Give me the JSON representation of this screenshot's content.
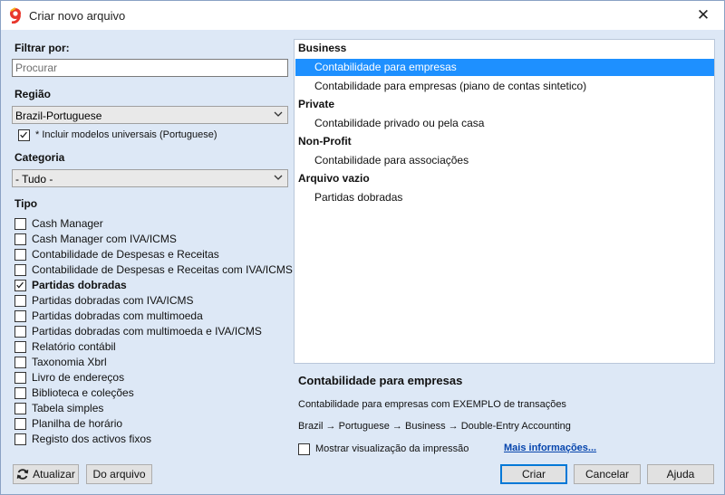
{
  "window": {
    "title": "Criar novo arquivo",
    "close_glyph": "✕",
    "icon": "app-logo-icon"
  },
  "filter": {
    "label": "Filtrar por:",
    "search_placeholder": "Procurar",
    "search_value": ""
  },
  "region": {
    "label": "Região",
    "selected": "Brazil-Portuguese",
    "include_universal": {
      "label": "* Incluir modelos universais (Portuguese)",
      "checked": true
    }
  },
  "category": {
    "label": "Categoria",
    "selected": "- Tudo -"
  },
  "type": {
    "label": "Tipo",
    "items": [
      {
        "label": "Cash Manager",
        "checked": false
      },
      {
        "label": "Cash Manager com IVA/ICMS",
        "checked": false
      },
      {
        "label": "Contabilidade de Despesas e Receitas",
        "checked": false
      },
      {
        "label": "Contabilidade de Despesas e Receitas com IVA/ICMS",
        "checked": false
      },
      {
        "label": "Partidas dobradas",
        "checked": true
      },
      {
        "label": "Partidas dobradas com IVA/ICMS",
        "checked": false
      },
      {
        "label": "Partidas dobradas com multimoeda",
        "checked": false
      },
      {
        "label": "Partidas dobradas com multimoeda e IVA/ICMS",
        "checked": false
      },
      {
        "label": "Relatório contábil",
        "checked": false
      },
      {
        "label": "Taxonomia Xbrl",
        "checked": false
      },
      {
        "label": "Livro de endereços",
        "checked": false
      },
      {
        "label": "Biblioteca e coleções",
        "checked": false
      },
      {
        "label": "Tabela simples",
        "checked": false
      },
      {
        "label": "Planilha de horário",
        "checked": false
      },
      {
        "label": "Registo dos activos fixos",
        "checked": false
      }
    ]
  },
  "templates": {
    "groups": [
      {
        "name": "Business",
        "items": [
          {
            "label": "Contabilidade para empresas",
            "selected": true
          },
          {
            "label": "Contabilidade para empresas (piano de contas sintetico)",
            "selected": false
          }
        ]
      },
      {
        "name": "Private",
        "items": [
          {
            "label": "Contabilidade privado ou pela casa",
            "selected": false
          }
        ]
      },
      {
        "name": "Non-Profit",
        "items": [
          {
            "label": "Contabilidade para associações",
            "selected": false
          }
        ]
      },
      {
        "name": "Arquivo vazio",
        "items": [
          {
            "label": "Partidas dobradas",
            "selected": false
          }
        ]
      }
    ]
  },
  "detail": {
    "title": "Contabilidade para empresas",
    "description": "Contabilidade para empresas com EXEMPLO de transações",
    "path": "Brazil → Portuguese → Business → Double-Entry Accounting",
    "preview_label": "Mostrar visualização da impressão",
    "preview_checked": false,
    "more_link": "Mais informações..."
  },
  "buttons": {
    "refresh": "Atualizar",
    "from_file": "Do arquivo",
    "create": "Criar",
    "cancel": "Cancelar",
    "help": "Ajuda"
  },
  "colors": {
    "selection": "#1e90ff",
    "background": "#dde8f6",
    "link": "#0645ad"
  }
}
